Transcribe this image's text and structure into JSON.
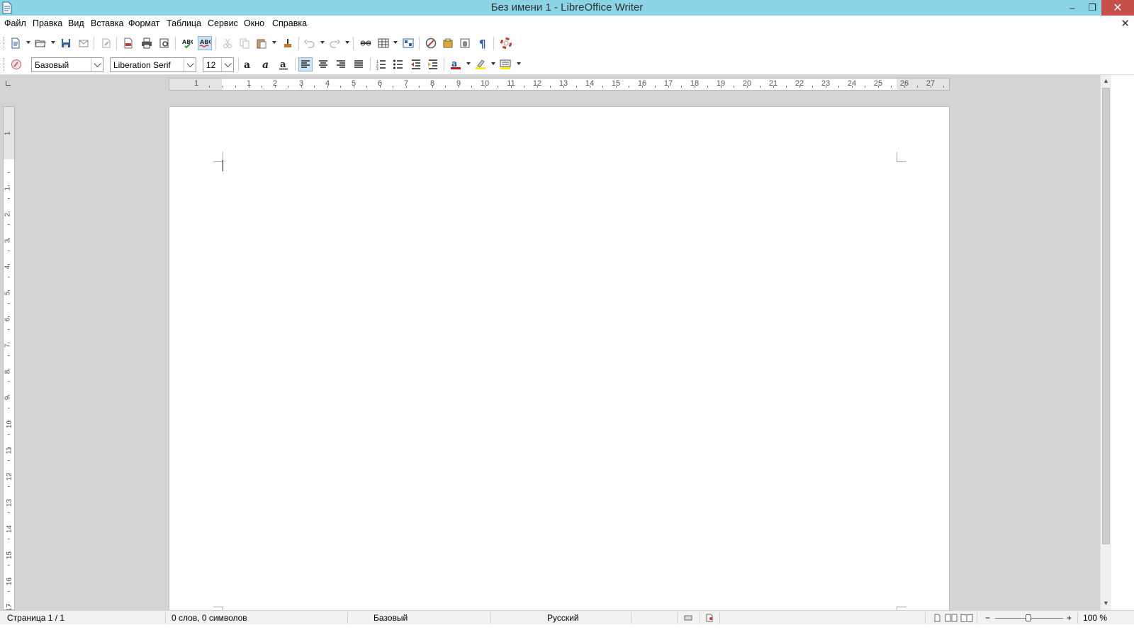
{
  "window": {
    "title": "Без имени 1 - LibreOffice Writer",
    "minimize_glyph": "–",
    "maximize_glyph": "❐",
    "close_glyph": "✕"
  },
  "menubar": {
    "items": [
      "Файл",
      "Правка",
      "Вид",
      "Вставка",
      "Формат",
      "Таблица",
      "Сервис",
      "Окно",
      "Справка"
    ],
    "doc_close_glyph": "✕"
  },
  "formatting": {
    "paragraph_style": "Базовый",
    "font_name": "Liberation Serif",
    "font_size": "12"
  },
  "ruler": {
    "horizontal_numbers": [
      "1",
      "1",
      "2",
      "3",
      "4",
      "5",
      "6",
      "7",
      "8",
      "9",
      "10",
      "11",
      "12",
      "13",
      "14",
      "15",
      "16",
      "17",
      "18",
      "19",
      "20",
      "21",
      "22",
      "23",
      "24",
      "25",
      "26",
      "27"
    ],
    "vertical_numbers": [
      "1",
      "1",
      "2",
      "3",
      "4",
      "5",
      "6",
      "7",
      "8",
      "9",
      "10",
      "11",
      "12",
      "13",
      "14",
      "15",
      "16",
      "17"
    ]
  },
  "statusbar": {
    "page": "Страница 1 / 1",
    "words": "0 слов, 0 символов",
    "style": "Базовый",
    "language": "Русский",
    "zoom": "100 %",
    "zoom_minus": "−",
    "zoom_plus": "+"
  },
  "colors": {
    "titlebar": "#8bd4e6",
    "close_button": "#c7504a",
    "workspace": "#d4d4d4"
  }
}
